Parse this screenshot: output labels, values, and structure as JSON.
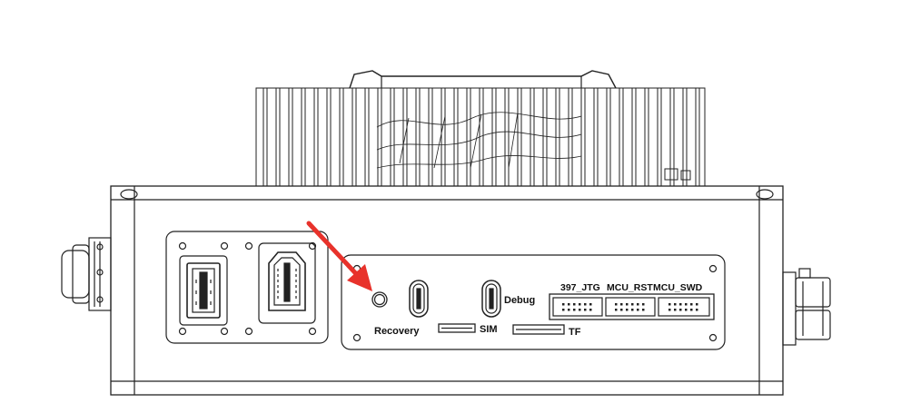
{
  "labels": {
    "recovery": "Recovery",
    "debug": "Debug",
    "sim": "SIM",
    "tf": "TF",
    "jtg": "397_JTG",
    "mcu_rst": "MCU_RST",
    "mcu_swd": "MCU_SWD"
  },
  "colors": {
    "line": "#222222",
    "arrow": "#e8322b",
    "background": "#ffffff"
  }
}
